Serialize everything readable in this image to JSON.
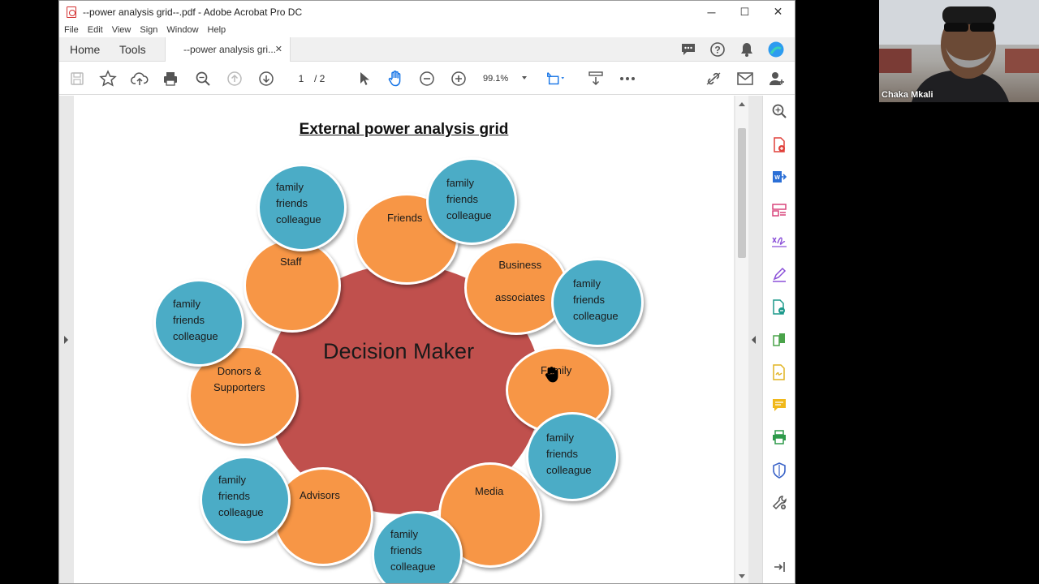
{
  "window": {
    "title": "--power analysis grid--.pdf - Adobe Acrobat Pro DC",
    "minimize": "─",
    "maximize": "☐",
    "close": "✕"
  },
  "menu": [
    "File",
    "Edit",
    "View",
    "Sign",
    "Window",
    "Help"
  ],
  "tabs": {
    "home": "Home",
    "tools": "Tools",
    "doc": "--power analysis gri...",
    "doc_close": "✕"
  },
  "toolbar": {
    "page_current": "1",
    "page_total": "/ 2",
    "zoom": "99.1%"
  },
  "document": {
    "heading": "External power analysis grid",
    "center": "Decision Maker",
    "nodes": {
      "staff": "Staff",
      "friends": "Friends",
      "business": "Business\n\nassociates",
      "family": "Family",
      "media": "Media",
      "advisors": "Advisors",
      "donors": "Donors &\nSupporters",
      "ffc": "family\nfriends\ncolleague"
    }
  },
  "webcam": {
    "name": "Chaka Mkali"
  },
  "colors": {
    "center": "#c0504d",
    "orange": "#f79646",
    "blue": "#4bacc6",
    "acrobat_accent": "#1473e6"
  }
}
